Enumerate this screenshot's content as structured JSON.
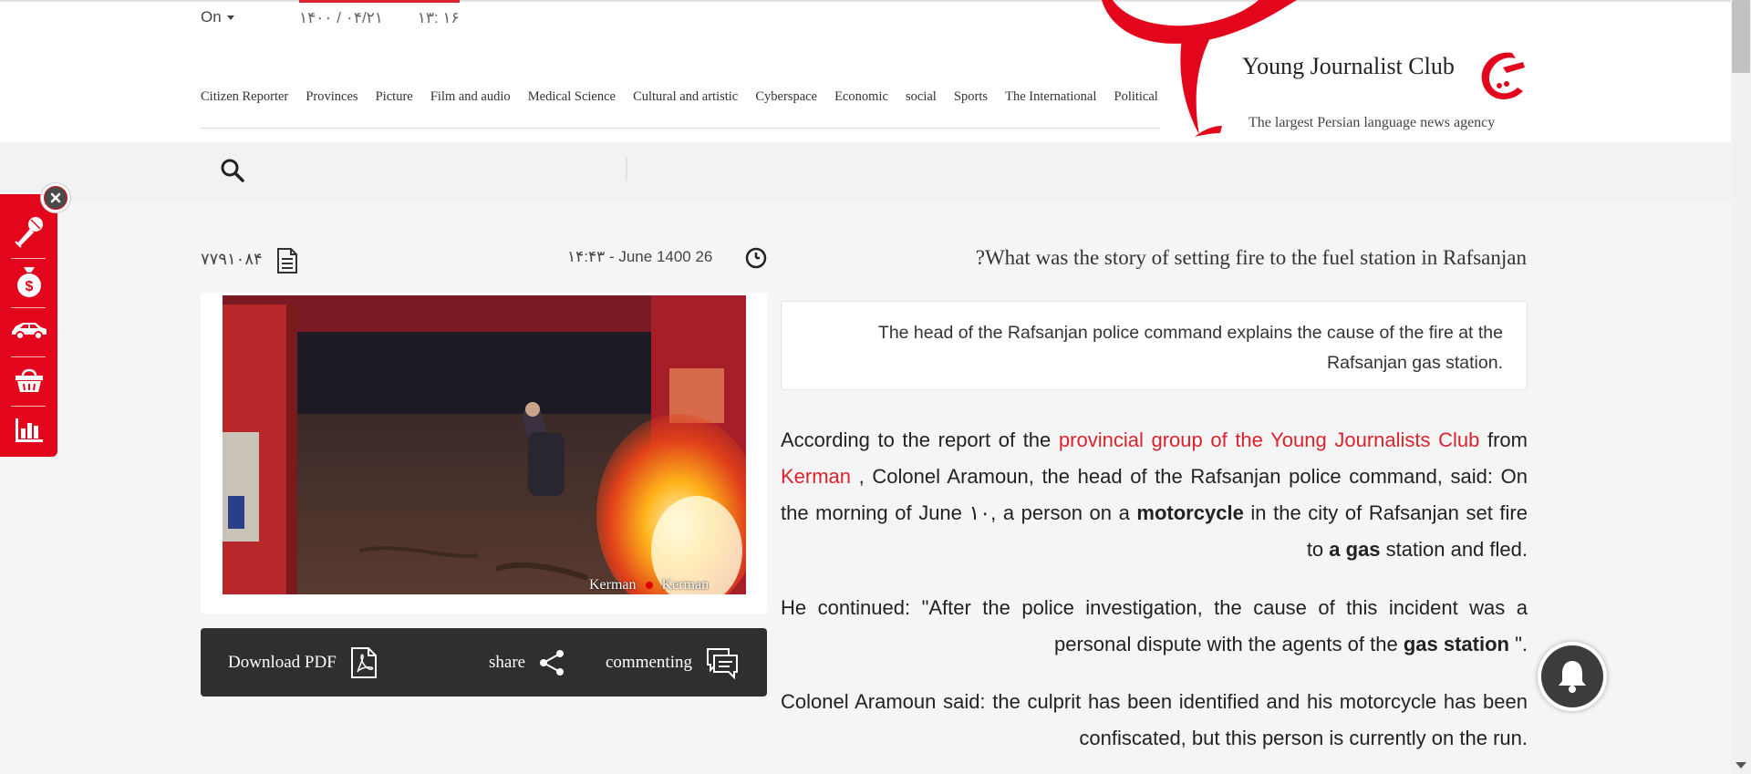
{
  "header": {
    "language": "On",
    "date": "۱۴۰۰ / ۰۴/۲۱",
    "time": "۱۳: ۱۶",
    "brand_name": "Young Journalist Club",
    "brand_tagline": "The largest Persian language news agency",
    "nav_items": [
      "Citizen Reporter",
      "Provinces",
      "Picture",
      "Film and audio",
      "Medical Science",
      "Cultural and artistic",
      "Cyberspace",
      "Economic",
      "social",
      "Sports",
      "The International",
      "Political"
    ]
  },
  "search": {
    "icon": "search-icon"
  },
  "side_toolbar": {
    "icons": [
      "microphone-icon",
      "money-bag-icon",
      "car-icon",
      "shopping-basket-icon",
      "bar-chart-icon"
    ],
    "close_icon": "close-icon"
  },
  "article": {
    "news_id": "۷۷۹۱۰۸۴",
    "published": "۱۴:۴۳ - June 1400 26",
    "title": "?What was the story of setting fire to the fuel station in Rafsanjan",
    "lead": "The head of the Rafsanjan police command explains the cause of the fire at the Rafsanjan gas station.",
    "photo_watermark_left": "Kerman",
    "photo_watermark_right": "Kerman",
    "paragraphs": {
      "p1_a": "According to the report of the ",
      "p1_link": "provincial group of the Young Journalists Club",
      "p1_b": " from ",
      "p1_link2": "Kerman",
      "p1_c": " , Colonel Aramoun, the head of the Rafsanjan police command, said: On the morning of June ۱۰, a person on a ",
      "p1_bold": "motorcycle",
      "p1_d": " in the city of Rafsanjan set fire to ",
      "p1_bold2": "a gas",
      "p1_e": " station and fled.",
      "p2_a": "He continued: \"After the police investigation, the cause of this incident was a personal dispute with the agents of the ",
      "p2_bold": "gas station",
      "p2_b": " \".",
      "p3": "Colonel Aramoun said: the culprit has been identified and his motorcycle has been confiscated, but this person is currently on the run."
    }
  },
  "actions": {
    "download_pdf": "Download PDF",
    "share": "share",
    "commenting": "commenting"
  },
  "colors": {
    "brand_red": "#d9232d",
    "toolbar_red": "#e3051b",
    "action_bar": "#2f2f2f"
  }
}
